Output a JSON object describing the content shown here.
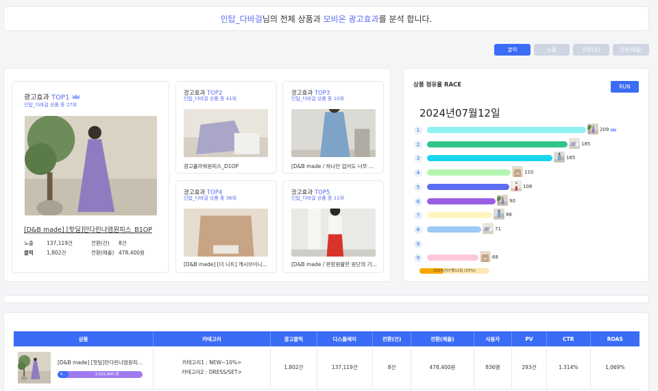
{
  "banner": {
    "shop_name": "인탑_다바걸",
    "text_mid": "님의 전체 상품과 ",
    "platform": "모비온 광고효과",
    "text_end": "를 분석 합니다."
  },
  "filters": [
    {
      "label": "클릭",
      "active": true
    },
    {
      "label": "노출",
      "active": false
    },
    {
      "label": "전환(건)",
      "active": false
    },
    {
      "label": "전환(매출)",
      "active": false
    }
  ],
  "top_products": {
    "top1": {
      "title_prefix": "광고효과 ",
      "rank_label": "TOP1",
      "sub": "인탑_다바걸 상품 중 27위",
      "name": "[D&B made] [핫딜]만다린나염원피스_B1OP",
      "stats": {
        "impressions_label": "노출",
        "impressions": "137,119건",
        "conv_count_label": "전환(건)",
        "conv_count": "8건",
        "clicks_label": "클릭",
        "clicks": "1,802건",
        "conv_sales_label": "전환(매출)",
        "conv_sales": "478,400원"
      }
    },
    "top2": {
      "title_prefix": "광고효과 ",
      "rank_label": "TOP2",
      "sub": "인탑_다바걸 상품 중 41위",
      "name": "광고플라워원피스_D1OP"
    },
    "top3": {
      "title_prefix": "광고효과 ",
      "rank_label": "TOP3",
      "sub": "인탑_다바걸 상품 중 10위",
      "name": "[D&B made / 하나만 입어도 너무 예..."
    },
    "top4": {
      "title_prefix": "광고효과 ",
      "rank_label": "TOP4",
      "sub": "인탑_다바걸 상품 중 36위",
      "name": "[D&B made] [더 니트] 캐시브이니트..."
    },
    "top5": {
      "title_prefix": "광고효과 ",
      "rank_label": "TOP5",
      "sub": "인탑_다바걸 상품 중 11위",
      "name": "[D&B made / 완항원활한 원단의 기..."
    }
  },
  "race": {
    "title": "상품 점유율 RACE",
    "run_label": "RUN",
    "date": "2024년07월12일",
    "progress_label": "2024년07월12일 [33%]",
    "progress": 0.33,
    "max_value": 209,
    "rows": [
      {
        "rank": "1",
        "value": 209,
        "color": "#8ef0f3",
        "label": "209",
        "crown": true
      },
      {
        "rank": "2",
        "value": 185,
        "color": "#30c48b",
        "label": "185"
      },
      {
        "rank": "3",
        "value": 165,
        "color": "#1ad5f0",
        "label": "165"
      },
      {
        "rank": "4",
        "value": 110,
        "color": "#b3f5b0",
        "label": "110"
      },
      {
        "rank": "5",
        "value": 108,
        "color": "#5b6cf0",
        "label": "108"
      },
      {
        "rank": "6",
        "value": 90,
        "color": "#9b5de5",
        "label": "90"
      },
      {
        "rank": "7",
        "value": 86,
        "color": "#fff6c2",
        "label": "86"
      },
      {
        "rank": "8",
        "value": 71,
        "color": "#9cc9f5",
        "label": "71"
      },
      {
        "rank": "9",
        "value": 0,
        "color": "#ffffff",
        "label": ""
      },
      {
        "rank": "9",
        "value": 68,
        "color": "#ffc8d8",
        "label": "68"
      }
    ]
  },
  "table": {
    "headers": [
      "상품",
      "카테고리",
      "광고클릭",
      "디스플레이",
      "전환(건)",
      "전환(매출)",
      "사용자",
      "PV",
      "CTR",
      "ROAS"
    ],
    "row": {
      "name": "[D&B made] [핫딜]만다린나염원피스...",
      "bar_left": "4...",
      "bar_right": "3,625,800 원",
      "cat1": "카테고리1 : NEW~10%>",
      "cat2": "카테고리2 : DRESS/SET>",
      "clicks": "1,802건",
      "display": "137,119건",
      "conv": "8건",
      "sales": "478,400원",
      "users": "836명",
      "pv": "293건",
      "ctr": "1.314%",
      "roas": "1,069%"
    }
  },
  "colors": {
    "accent": "#3b6cf6",
    "highlight": "#5b6cf0",
    "progress": "#f5a800"
  }
}
